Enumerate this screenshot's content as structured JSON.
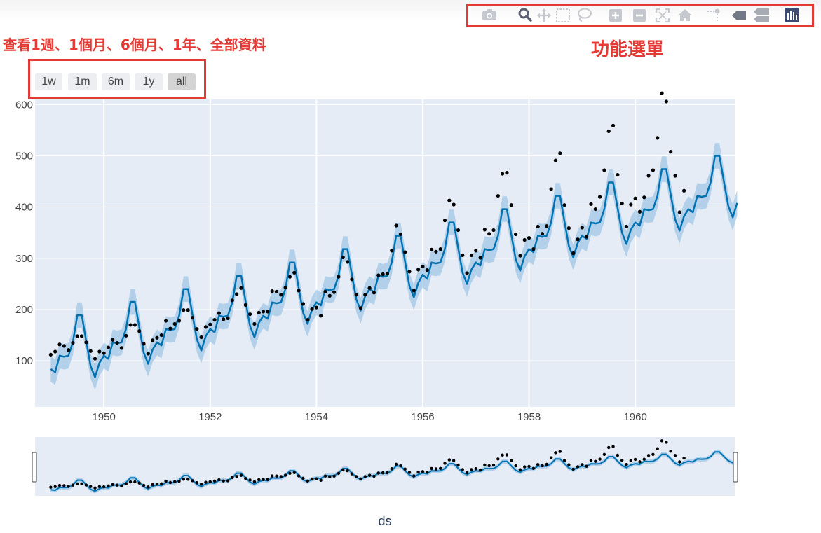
{
  "annotations": {
    "range_note": "查看1週、1個月、6個月、1年、全部資料",
    "menu_note": "功能選單"
  },
  "range_selector": {
    "buttons": [
      "1w",
      "1m",
      "6m",
      "1y",
      "all"
    ],
    "active": "all"
  },
  "modebar": {
    "icons": [
      "camera-icon",
      "zoom-icon",
      "pan-icon",
      "box-select-icon",
      "lasso-select-icon",
      "zoom-in-icon",
      "zoom-out-icon",
      "autoscale-icon",
      "reset-axes-icon",
      "spike-lines-icon",
      "hover-closest-icon",
      "hover-compare-icon",
      "plotly-logo-icon"
    ],
    "active_icon": "zoom-icon"
  },
  "colors": {
    "plot_bg": "#e5ecf6",
    "grid": "#ffffff",
    "line": "#0072b2",
    "band": "#9cc4e4",
    "points": "#000000",
    "annotation": "#e53935",
    "tick_text": "#444444"
  },
  "chart_data": {
    "type": "line",
    "xlabel": "ds",
    "ylabel": "",
    "title": "",
    "xlim": [
      "1948-09-15",
      "1961-11-15"
    ],
    "ylim": [
      10,
      610
    ],
    "xticks": [
      "1950",
      "1952",
      "1954",
      "1956",
      "1958",
      "1960"
    ],
    "yticks": [
      100,
      200,
      300,
      400,
      500,
      600
    ],
    "grid": true,
    "range_slider": true,
    "actual": {
      "start": "1949-01",
      "values": [
        112,
        118,
        132,
        129,
        121,
        135,
        148,
        148,
        136,
        119,
        104,
        118,
        115,
        126,
        141,
        135,
        125,
        149,
        170,
        170,
        158,
        133,
        114,
        140,
        145,
        150,
        178,
        163,
        172,
        178,
        199,
        199,
        184,
        162,
        146,
        166,
        171,
        180,
        193,
        181,
        183,
        218,
        230,
        242,
        209,
        191,
        172,
        194,
        196,
        196,
        236,
        235,
        229,
        243,
        264,
        272,
        237,
        211,
        180,
        201,
        204,
        188,
        235,
        227,
        234,
        264,
        302,
        293,
        259,
        229,
        203,
        229,
        242,
        233,
        267,
        269,
        270,
        315,
        364,
        347,
        312,
        274,
        237,
        278,
        284,
        277,
        317,
        313,
        318,
        374,
        413,
        405,
        355,
        306,
        271,
        306,
        315,
        301,
        356,
        348,
        355,
        422,
        465,
        467,
        404,
        347,
        305,
        336,
        340,
        318,
        362,
        348,
        363,
        435,
        491,
        505,
        404,
        359,
        310,
        337,
        360,
        342,
        406,
        396,
        420,
        472,
        548,
        559,
        463,
        407,
        362,
        405,
        417,
        391,
        419,
        461,
        472,
        535,
        622,
        606,
        508,
        461,
        390,
        432
      ]
    },
    "forecast": {
      "start": "1949-01",
      "values": [
        84,
        78,
        110,
        108,
        110,
        136,
        189,
        189,
        139,
        90,
        68,
        96,
        110,
        104,
        136,
        134,
        136,
        162,
        215,
        215,
        165,
        116,
        94,
        122,
        136,
        130,
        162,
        160,
        162,
        188,
        240,
        240,
        190,
        142,
        120,
        148,
        162,
        156,
        188,
        186,
        188,
        214,
        266,
        266,
        216,
        168,
        146,
        174,
        188,
        182,
        214,
        212,
        214,
        240,
        292,
        292,
        242,
        194,
        172,
        200,
        214,
        208,
        240,
        238,
        240,
        266,
        318,
        318,
        268,
        220,
        198,
        226,
        240,
        234,
        266,
        264,
        266,
        292,
        344,
        344,
        294,
        246,
        224,
        252,
        268,
        260,
        292,
        290,
        292,
        318,
        370,
        370,
        320,
        272,
        250,
        278,
        292,
        286,
        318,
        316,
        318,
        344,
        396,
        396,
        346,
        298,
        276,
        304,
        318,
        312,
        344,
        342,
        344,
        370,
        422,
        422,
        372,
        324,
        302,
        330,
        344,
        338,
        370,
        368,
        370,
        396,
        448,
        448,
        398,
        350,
        328,
        356,
        370,
        364,
        396,
        394,
        396,
        422,
        474,
        474,
        424,
        376,
        354,
        382,
        396,
        390,
        422,
        420,
        422,
        448,
        500,
        500,
        450,
        402,
        380,
        408
      ],
      "band_halfwidth": 25
    }
  }
}
